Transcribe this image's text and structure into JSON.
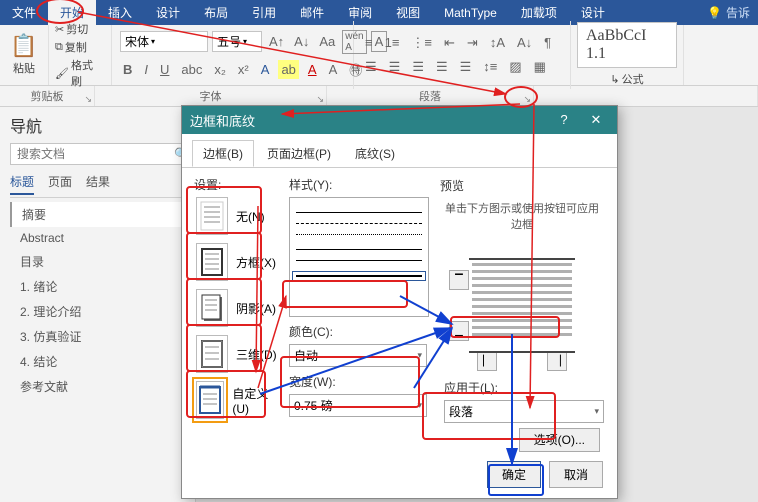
{
  "menu": {
    "file": "文件",
    "home": "开始",
    "insert": "插入",
    "design": "设计",
    "layout": "布局",
    "references": "引用",
    "mailings": "邮件",
    "review": "审阅",
    "view": "视图",
    "mathtype": "MathType",
    "addins": "加载项",
    "design2": "设计",
    "tell": "告诉"
  },
  "ribbon": {
    "paste": "粘贴",
    "cut": "剪切",
    "copy": "复制",
    "formatpainter": "格式刷",
    "font_name": "宋体",
    "font_size": "五号",
    "style_text": "AaBbCcI 1.1",
    "formula": "公式",
    "groups": {
      "clipboard": "剪贴板",
      "font": "字体",
      "paragraph": "段落"
    }
  },
  "nav": {
    "title": "导航",
    "search_ph": "搜索文档",
    "tabs": {
      "headings": "标题",
      "pages": "页面",
      "results": "结果"
    },
    "items": [
      "摘要",
      "Abstract",
      "目录",
      "1. 绪论",
      "2. 理论介绍",
      "3. 仿真验证",
      "4. 结论",
      "参考文献"
    ]
  },
  "dialog": {
    "title": "边框和底纹",
    "help": "?",
    "close": "✕",
    "tabs": {
      "borders": "边框(B)",
      "page_borders": "页面边框(P)",
      "shading": "底纹(S)"
    },
    "settings_label": "设置:",
    "settings": {
      "none": "无(N)",
      "box": "方框(X)",
      "shadow": "阴影(A)",
      "three_d": "三维(D)",
      "custom": "自定义(U)"
    },
    "style_label": "样式(Y):",
    "color_label": "颜色(C):",
    "color_value": "自动",
    "width_label": "宽度(W):",
    "width_value": "0.75 磅",
    "preview_label": "预览",
    "preview_hint": "单击下方图示或使用按钮可应用边框",
    "apply_label": "应用于(L):",
    "apply_value": "段落",
    "options": "选项(O)...",
    "ok": "确定",
    "cancel": "取消"
  }
}
